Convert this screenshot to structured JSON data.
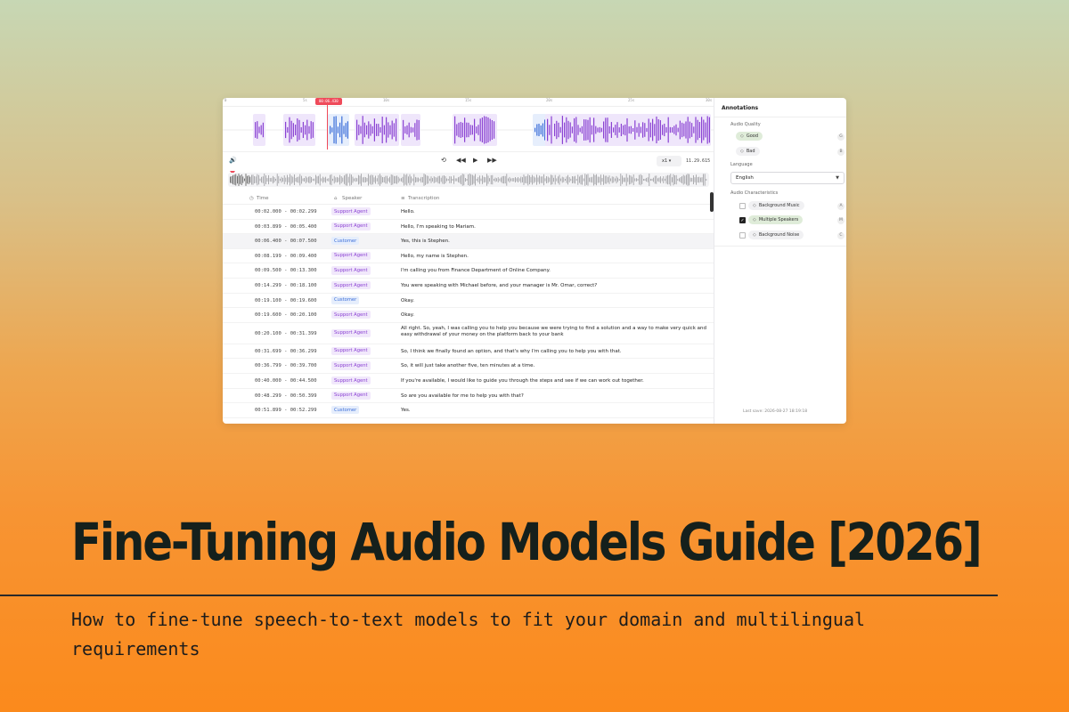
{
  "timeline": {
    "ticks": [
      "0",
      "5s",
      "10s",
      "15s",
      "20s",
      "25s",
      "30s"
    ],
    "playhead_time": "00:06.430",
    "colors": {
      "agent": "#8a41d3",
      "customer": "#3d6fd9",
      "playhead": "#ef4a5a"
    }
  },
  "controls": {
    "volume_icon": "volume-icon",
    "loop_icon": "loop-icon",
    "rewind_icon": "rewind-icon",
    "play_icon": "play-icon",
    "forward_icon": "fast-forward-icon",
    "speed": "x1",
    "current_time": "11.29.615"
  },
  "table": {
    "headers": {
      "time": "Time",
      "speaker": "Speaker",
      "transcription": "Transcription"
    },
    "rows": [
      {
        "time": "00:02.000 - 00:02.299",
        "speaker": "Support Agent",
        "text": "Hello."
      },
      {
        "time": "00:03.899 - 00:05.400",
        "speaker": "Support Agent",
        "text": "Hello, I'm speaking to Mariam."
      },
      {
        "time": "00:06.400 - 00:07.500",
        "speaker": "Customer",
        "text": "Yes, this is Stephen."
      },
      {
        "time": "00:08.199 - 00:09.400",
        "speaker": "Support Agent",
        "text": "Hello, my name is Stephen."
      },
      {
        "time": "00:09.500 - 00:13.300",
        "speaker": "Support Agent",
        "text": "I'm calling you from Finance Department of Online Company."
      },
      {
        "time": "00:14.299 - 00:18.100",
        "speaker": "Support Agent",
        "text": "You were speaking with Michael before, and your manager is Mr. Omar, correct?"
      },
      {
        "time": "00:19.100 - 00:19.600",
        "speaker": "Customer",
        "text": "Okay."
      },
      {
        "time": "00:19.600 - 00:20.100",
        "speaker": "Support Agent",
        "text": "Okay."
      },
      {
        "time": "00:20.100 - 00:31.399",
        "speaker": "Support Agent",
        "text": "All right. So, yeah, I was calling you to help you because we were trying to find a solution and a way to make very quick and easy withdrawal of your money on the platform back to your bank"
      },
      {
        "time": "00:31.699 - 00:36.299",
        "speaker": "Support Agent",
        "text": "So, I think we finally found an option, and that's why I'm calling you to help you with that."
      },
      {
        "time": "00:36.799 - 00:39.700",
        "speaker": "Support Agent",
        "text": "So, it will just take another five, ten minutes at a time."
      },
      {
        "time": "00:40.000 - 00:44.500",
        "speaker": "Support Agent",
        "text": "If you're available, I would like to guide you through the steps and see if we can work out together."
      },
      {
        "time": "00:48.299 - 00:50.399",
        "speaker": "Support Agent",
        "text": "So are you available for me to help you with that?"
      },
      {
        "time": "00:51.899 - 00:52.299",
        "speaker": "Customer",
        "text": "Yes."
      }
    ]
  },
  "annotations": {
    "title": "Annotations",
    "audio_quality": {
      "label": "Audio Quality",
      "options": [
        {
          "label": "Good",
          "key": "G",
          "selected": true
        },
        {
          "label": "Bad",
          "key": "B",
          "selected": false
        }
      ]
    },
    "language": {
      "label": "Language",
      "value": "English"
    },
    "characteristics": {
      "label": "Audio Characteristics",
      "options": [
        {
          "label": "Background Music",
          "key": "A",
          "checked": false
        },
        {
          "label": "Multiple Speakers",
          "key": "M",
          "checked": true
        },
        {
          "label": "Background Noise",
          "key": "C",
          "checked": false
        }
      ]
    },
    "last_save": "Last save: 2026-08-27 18:19:18"
  },
  "headline": {
    "title": "Fine-Tuning Audio Models Guide [2026]",
    "subtitle": "How to fine-tune speech-to-text models to fit your domain and multilingual requirements"
  }
}
